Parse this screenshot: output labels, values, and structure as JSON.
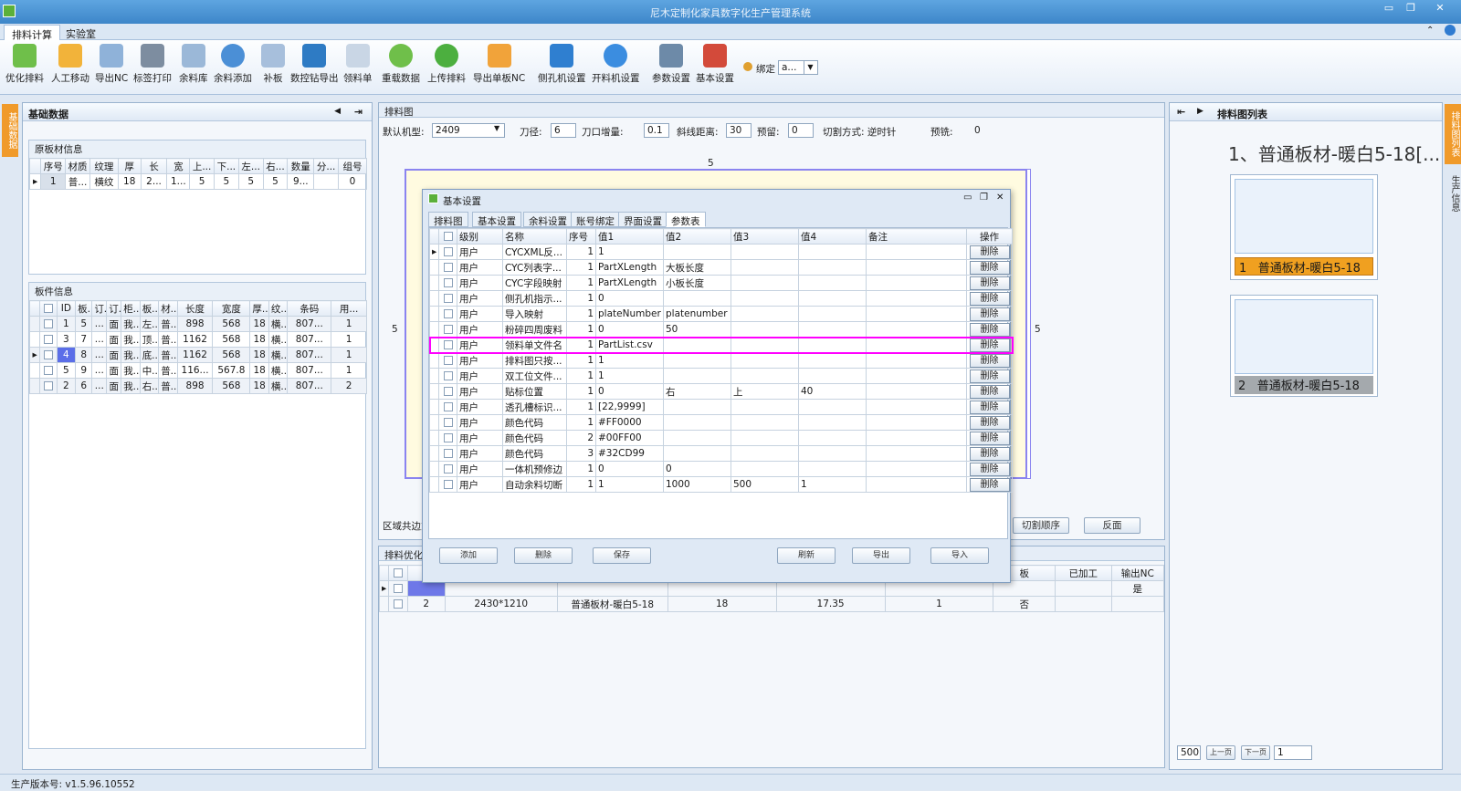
{
  "app": {
    "title": "尼木定制化家具数字化生产管理系统"
  },
  "ribbon": {
    "tabs": [
      "排料计算",
      "实验室"
    ],
    "tools": [
      "优化排料",
      "人工移动",
      "导出NC",
      "标签打印",
      "余料库",
      "余料添加",
      "补板",
      "数控钻导出",
      "领料单",
      "重载数据",
      "上传排料",
      "导出单板NC",
      "侧孔机设置",
      "开料机设置",
      "参数设置",
      "基本设置"
    ],
    "bind_label": "绑定",
    "bind_value": "a..."
  },
  "left": {
    "title": "基础数据",
    "sidetab": "基础数据",
    "raw_title": "原板材信息",
    "raw_cols": [
      "序号",
      "材质",
      "纹理",
      "厚",
      "长",
      "宽",
      "上...",
      "下...",
      "左...",
      "右...",
      "数量",
      "分...",
      "组号"
    ],
    "raw_rows": [
      [
        "1",
        "普...",
        "横纹",
        "18",
        "2...",
        "1...",
        "5",
        "5",
        "5",
        "5",
        "9...",
        "",
        "0"
      ]
    ],
    "parts_title": "板件信息",
    "parts_cols": [
      "",
      "ID",
      "板..",
      "订..",
      "订..",
      "柜..",
      "板..",
      "材..",
      "长度",
      "宽度",
      "厚..",
      "纹..",
      "条码",
      "用..."
    ],
    "parts_rows": [
      [
        "",
        "1",
        "5",
        "...",
        "面",
        "我..",
        "左..",
        "普..",
        "898",
        "568",
        "18",
        "横..",
        "807...",
        "1"
      ],
      [
        "",
        "3",
        "7",
        "...",
        "面",
        "我..",
        "顶..",
        "普..",
        "1162",
        "568",
        "18",
        "横..",
        "807...",
        "1"
      ],
      [
        "",
        "4",
        "8",
        "...",
        "面",
        "我..",
        "底..",
        "普..",
        "1162",
        "568",
        "18",
        "横..",
        "807...",
        "1"
      ],
      [
        "",
        "5",
        "9",
        "...",
        "面",
        "我..",
        "中..",
        "普..",
        "116...",
        "567.8",
        "18",
        "横..",
        "807...",
        "1"
      ],
      [
        "",
        "2",
        "6",
        "...",
        "面",
        "我..",
        "右..",
        "普..",
        "898",
        "568",
        "18",
        "横..",
        "807...",
        "2"
      ]
    ]
  },
  "center": {
    "title": "排料图",
    "params": {
      "machine_label": "默认机型:",
      "machine": "2409",
      "knife_label": "刀径:",
      "knife": "6",
      "incr_label": "刀口增量:",
      "incr": "0.1",
      "slope_label": "斜线距离:",
      "slope": "30",
      "reserve_label": "预留:",
      "reserve": "0",
      "cut_label": "切割方式: 逆时针",
      "pre_label": "预铣:",
      "pre": "0"
    },
    "dim_top": "5",
    "dim_left": "5",
    "dim_right": "5",
    "region_label": "区域共边方",
    "order_btn": "切割顺序",
    "back_btn": "反面",
    "opt_title": "排料优化方",
    "result_cols": [
      "",
      "",
      "",
      "",
      "",
      "",
      "",
      "",
      "板",
      "已加工",
      "输出NC"
    ],
    "result_rows": [
      {
        "no": "",
        "size": "",
        "name": "",
        "thick": "",
        "usage": "",
        "count": "",
        "board": "",
        "done": "",
        "nc": "是"
      },
      {
        "no": "2",
        "size": "2430*1210",
        "name": "普通板材-暖白5-18",
        "thick": "18",
        "usage": "17.35",
        "count": "1",
        "board": "否",
        "done": "",
        "nc": ""
      }
    ]
  },
  "right": {
    "title": "排料图列表",
    "sidetab1": "排料图列表",
    "sidetab2": "生产信息",
    "heading": "1、普通板材-暖白5-18[...",
    "items": [
      {
        "num": "1",
        "label": "普通板材-暖白5-18"
      },
      {
        "num": "2",
        "label": "普通板材-暖白5-18"
      }
    ],
    "page_size": "500",
    "prev": "上一页",
    "next": "下一页",
    "page": "1"
  },
  "dialog": {
    "title": "基本设置",
    "tabs": [
      "排料图",
      "基本设置",
      "余料设置",
      "账号绑定",
      "界面设置",
      "参数表"
    ],
    "cols": [
      "",
      "级别",
      "名称",
      "序号",
      "值1",
      "值2",
      "值3",
      "值4",
      "备注",
      "操作"
    ],
    "rows": [
      [
        "用户",
        "CYCXML反...",
        "1",
        "1",
        "",
        "",
        "",
        ""
      ],
      [
        "用户",
        "CYC列表字...",
        "1",
        "PartXLength",
        "大板长度",
        "",
        "",
        ""
      ],
      [
        "用户",
        "CYC字段映射",
        "1",
        "PartXLength",
        "小板长度",
        "",
        "",
        ""
      ],
      [
        "用户",
        "侧孔机指示...",
        "1",
        "0",
        "",
        "",
        "",
        ""
      ],
      [
        "用户",
        "导入映射",
        "1",
        "plateNumber",
        "platenumber",
        "",
        "",
        ""
      ],
      [
        "用户",
        "粉碎四周废料",
        "1",
        "0",
        "50",
        "",
        "",
        ""
      ],
      [
        "用户",
        "领料单文件名",
        "1",
        "PartList.csv",
        "",
        "",
        "",
        ""
      ],
      [
        "用户",
        "排料图只按...",
        "1",
        "1",
        "",
        "",
        "",
        ""
      ],
      [
        "用户",
        "双工位文件...",
        "1",
        "1",
        "",
        "",
        "",
        ""
      ],
      [
        "用户",
        "贴标位置",
        "1",
        "0",
        "右",
        "上",
        "40",
        ""
      ],
      [
        "用户",
        "透孔槽标识...",
        "1",
        "[22,9999]",
        "",
        "",
        "",
        ""
      ],
      [
        "用户",
        "颜色代码",
        "1",
        "#FF0000",
        "",
        "",
        "",
        ""
      ],
      [
        "用户",
        "颜色代码",
        "2",
        "#00FF00",
        "",
        "",
        "",
        ""
      ],
      [
        "用户",
        "颜色代码",
        "3",
        "#32CD99",
        "",
        "",
        "",
        ""
      ],
      [
        "用户",
        "一体机预修边",
        "1",
        "0",
        "0",
        "",
        "",
        ""
      ],
      [
        "用户",
        "自动余料切断",
        "1",
        "1",
        "1000",
        "500",
        "1",
        ""
      ]
    ],
    "delete_label": "删除",
    "buttons": [
      "添加",
      "删除",
      "保存",
      "刷新",
      "导出",
      "导入"
    ]
  },
  "status": {
    "version": "生产版本号: v1.5.96.10552"
  },
  "colors": {
    "accent": "#f09a2a",
    "highlight": "#ff00ff",
    "selected_row": "#5b6ee8"
  }
}
